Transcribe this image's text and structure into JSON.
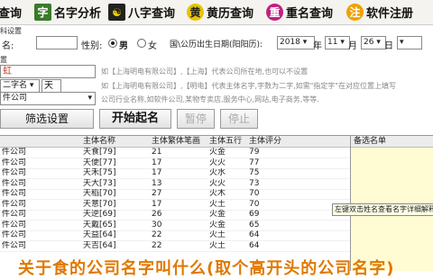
{
  "toolbar": {
    "items": [
      {
        "label": "查询",
        "icon": ""
      },
      {
        "label": "名字分析",
        "icon": "字"
      },
      {
        "label": "八字查询",
        "icon": "☯"
      },
      {
        "label": "黄历查询",
        "icon": "黄"
      },
      {
        "label": "重名查询",
        "icon": "重"
      },
      {
        "label": "软件注册",
        "icon": "注"
      }
    ]
  },
  "settings": {
    "group_caption": "科设置",
    "name_label": "名:",
    "gender_label": "性别:",
    "gender_male": "男",
    "gender_female": "女",
    "birth_label": "国\\公历出生日期(阳阳历):",
    "year_value": "2018",
    "year_unit": "年",
    "month_value": "11",
    "month_unit": "月",
    "day_value": "26",
    "day_unit": "日"
  },
  "company": {
    "group_caption": "置",
    "region_value": "虹",
    "region_hint": "如【上海明电有限公司】,【上海】代表公司所在地,也可以不设置",
    "mode_value": "二字名",
    "fixed_char_value": "天",
    "mode_hint": "如【上海明电有限公司】,【明电】代表主体名字,字数为二字,如需\"指定字\"在对应位置上填写",
    "industry_value": "件公司",
    "industry_hint": "公司行业名称,如软件公司,某物专卖店,服务中心,网站,电子商务,等等."
  },
  "actions": {
    "filter_label": "筛选设置",
    "start_label": "开始起名",
    "pause_label": "暂停",
    "stop_label": "停止"
  },
  "table": {
    "headers": [
      "主体名称",
      "主体繁体笔画",
      "主体五行",
      "主体评分"
    ],
    "rows": [
      {
        "industry": "件公司",
        "name": "天食[79]",
        "strokes": "21",
        "wuxing": "火金",
        "score": "79"
      },
      {
        "industry": "件公司",
        "name": "天便[77]",
        "strokes": "17",
        "wuxing": "火火",
        "score": "77"
      },
      {
        "industry": "件公司",
        "name": "天禾[75]",
        "strokes": "17",
        "wuxing": "火水",
        "score": "75"
      },
      {
        "industry": "件公司",
        "name": "天大[73]",
        "strokes": "13",
        "wuxing": "火火",
        "score": "73"
      },
      {
        "industry": "件公司",
        "name": "天稻[70]",
        "strokes": "27",
        "wuxing": "火木",
        "score": "70"
      },
      {
        "industry": "件公司",
        "name": "天意[70]",
        "strokes": "17",
        "wuxing": "火土",
        "score": "70"
      },
      {
        "industry": "件公司",
        "name": "天逆[69]",
        "strokes": "26",
        "wuxing": "火金",
        "score": "69"
      },
      {
        "industry": "件公司",
        "name": "天戴[65]",
        "strokes": "30",
        "wuxing": "火金",
        "score": "65"
      },
      {
        "industry": "件公司",
        "name": "天益[64]",
        "strokes": "22",
        "wuxing": "火土",
        "score": "64"
      },
      {
        "industry": "件公司",
        "name": "天吉[64]",
        "strokes": "22",
        "wuxing": "火土",
        "score": "64"
      }
    ]
  },
  "favorites": {
    "header": "备选名单",
    "tooltip": "左键双击姓名查看名字详细解释"
  },
  "banner": {
    "text": "关于食的公司名字叫什么(取个高开头的公司名字)"
  },
  "colors": {
    "brand_red": "#c0392b",
    "favorites_bg": "#fffbd2",
    "banner": "#e07800"
  }
}
